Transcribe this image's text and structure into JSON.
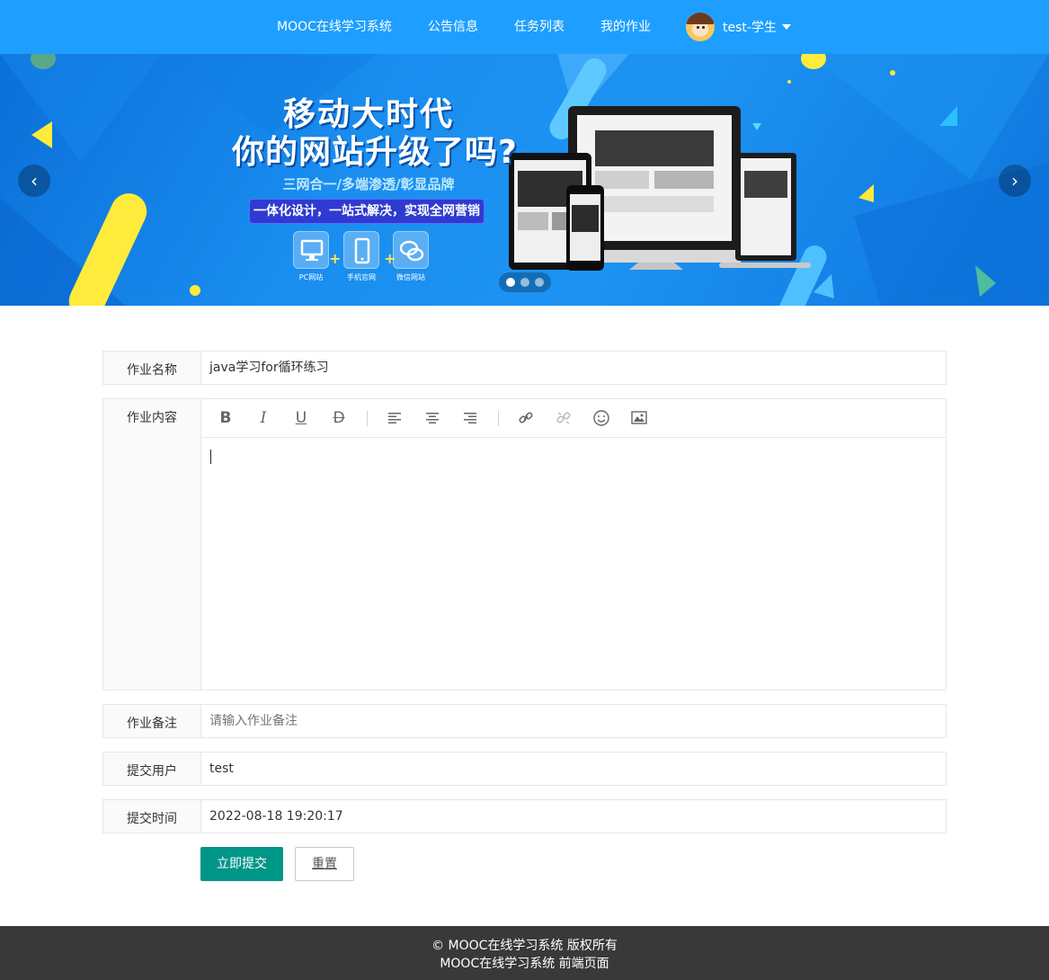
{
  "nav": {
    "brand": "MOOC在线学习系统",
    "items": [
      "公告信息",
      "任务列表",
      "我的作业"
    ],
    "user": "test-学生"
  },
  "banner": {
    "headline1": "移动大时代",
    "headline2": "你的网站升级了吗?",
    "subline": "三网合一/多端渗透/彰显品牌",
    "pill": "一体化设计，一站式解决，实现全网营销",
    "features": [
      "PC网站",
      "手机官网",
      "微信网站"
    ],
    "prev": "‹",
    "next": "›",
    "slides": 3,
    "active_slide": 1
  },
  "form": {
    "name_label": "作业名称",
    "name_value": "java学习for循环练习",
    "content_label": "作业内容",
    "remark_label": "作业备注",
    "remark_placeholder": "请输入作业备注",
    "user_label": "提交用户",
    "user_value": "test",
    "time_label": "提交时间",
    "time_value": "2022-08-18 19:20:17",
    "submit": "立即提交",
    "reset": "重置"
  },
  "editor_tools": [
    "bold-icon",
    "italic-icon",
    "underline-icon",
    "strikethrough-icon",
    "align-left-icon",
    "align-center-icon",
    "align-right-icon",
    "link-icon",
    "unlink-icon",
    "emoji-icon",
    "image-icon"
  ],
  "footer": {
    "line1": "© MOOC在线学习系统 版权所有",
    "line2": "MOOC在线学习系统 前端页面"
  },
  "colors": {
    "nav_bg": "#1e9fff",
    "submit_bg": "#009688",
    "footer_bg": "#393939"
  }
}
